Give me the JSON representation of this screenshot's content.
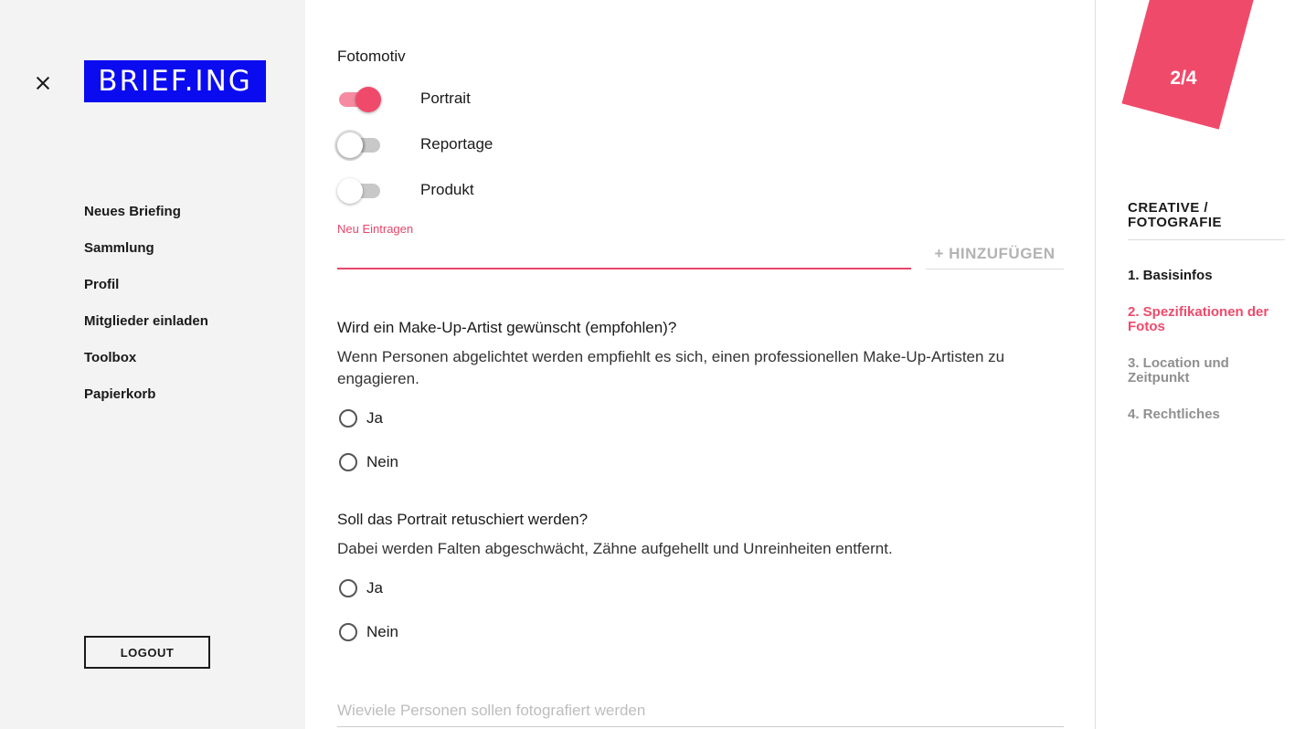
{
  "sidebar": {
    "logo_text": "BRIEF.ING",
    "nav_items": [
      {
        "label": "Neues Briefing"
      },
      {
        "label": "Sammlung"
      },
      {
        "label": "Profil"
      },
      {
        "label": "Mitglieder einladen"
      },
      {
        "label": "Toolbox"
      },
      {
        "label": "Papierkorb"
      }
    ],
    "logout_label": "LOGOUT"
  },
  "form": {
    "section_title": "Fotomotiv",
    "motifs": [
      {
        "label": "Portrait",
        "checked": true
      },
      {
        "label": "Reportage",
        "checked": false
      },
      {
        "label": "Produkt",
        "checked": false
      }
    ],
    "new_entry_label": "Neu Eintragen",
    "new_entry_value": "",
    "add_button_label": "+ HINZUFÜGEN",
    "q1": {
      "question": "Wird ein Make-Up-Artist gewünscht (empfohlen)?",
      "hint": "Wenn Personen abgelichtet werden empfiehlt es sich, einen professionellen Make-Up-Artisten zu engagieren.",
      "options": [
        {
          "label": "Ja"
        },
        {
          "label": "Nein"
        }
      ]
    },
    "q2": {
      "question": "Soll das Portrait retuschiert werden?",
      "hint": "Dabei werden Falten abgeschwächt, Zähne aufgehellt und Unreinheiten entfernt.",
      "options": [
        {
          "label": "Ja"
        },
        {
          "label": "Nein"
        }
      ]
    },
    "persons_placeholder": "Wieviele Personen sollen fotografiert werden"
  },
  "progress": {
    "badge": "2/4",
    "category": "CREATIVE / FOTOGRAFIE",
    "steps": [
      {
        "label": "1. Basisinfos",
        "state": "done"
      },
      {
        "label": "2. Spezifikationen der Fotos",
        "state": "active"
      },
      {
        "label": "3. Location und Zeitpunkt",
        "state": "todo"
      },
      {
        "label": "4. Rechtliches",
        "state": "todo"
      }
    ]
  },
  "colors": {
    "brand_blue": "#0b0bf0",
    "accent_pink": "#f04a6b"
  }
}
